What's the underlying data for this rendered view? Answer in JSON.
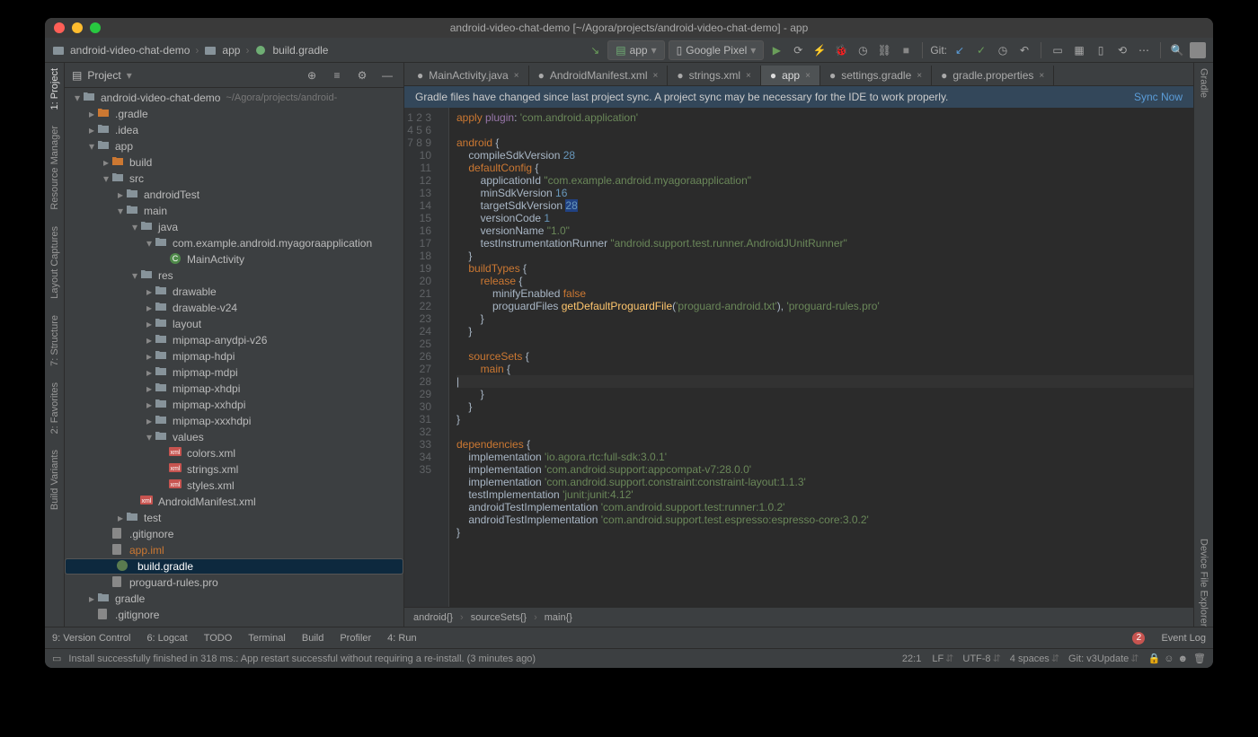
{
  "title": "android-video-chat-demo [~/Agora/projects/android-video-chat-demo] - app",
  "crumbs": [
    "android-video-chat-demo",
    "app",
    "build.gradle"
  ],
  "runconfig": "app",
  "device": "Google Pixel",
  "git_label": "Git:",
  "left_tabs": [
    "1: Project",
    "Resource Manager",
    "Layout Captures",
    "7: Structure",
    "2: Favorites",
    "Build Variants"
  ],
  "right_tabs": [
    "Gradle",
    "Device File Explorer"
  ],
  "proj_label": "Project",
  "tree": [
    {
      "d": 0,
      "c": "▾",
      "i": "fldr",
      "t": "android-video-chat-demo",
      "dim": "~/Agora/projects/android-"
    },
    {
      "d": 1,
      "c": "▸",
      "i": "fldr-o",
      "t": ".gradle"
    },
    {
      "d": 1,
      "c": "▸",
      "i": "fldr",
      "t": ".idea"
    },
    {
      "d": 1,
      "c": "▾",
      "i": "fldr",
      "t": "app"
    },
    {
      "d": 2,
      "c": "▸",
      "i": "fldr-o",
      "t": "build"
    },
    {
      "d": 2,
      "c": "▾",
      "i": "fldr",
      "t": "src"
    },
    {
      "d": 3,
      "c": "▸",
      "i": "fldr",
      "t": "androidTest"
    },
    {
      "d": 3,
      "c": "▾",
      "i": "fldr",
      "t": "main"
    },
    {
      "d": 4,
      "c": "▾",
      "i": "fldr",
      "t": "java"
    },
    {
      "d": 5,
      "c": "▾",
      "i": "fldr",
      "t": "com.example.android.myagoraapplication"
    },
    {
      "d": 6,
      "c": "",
      "i": "cls",
      "t": "MainActivity"
    },
    {
      "d": 4,
      "c": "▾",
      "i": "fldr",
      "t": "res"
    },
    {
      "d": 5,
      "c": "▸",
      "i": "fldr",
      "t": "drawable"
    },
    {
      "d": 5,
      "c": "▸",
      "i": "fldr",
      "t": "drawable-v24"
    },
    {
      "d": 5,
      "c": "▸",
      "i": "fldr",
      "t": "layout"
    },
    {
      "d": 5,
      "c": "▸",
      "i": "fldr",
      "t": "mipmap-anydpi-v26"
    },
    {
      "d": 5,
      "c": "▸",
      "i": "fldr",
      "t": "mipmap-hdpi"
    },
    {
      "d": 5,
      "c": "▸",
      "i": "fldr",
      "t": "mipmap-mdpi"
    },
    {
      "d": 5,
      "c": "▸",
      "i": "fldr",
      "t": "mipmap-xhdpi"
    },
    {
      "d": 5,
      "c": "▸",
      "i": "fldr",
      "t": "mipmap-xxhdpi"
    },
    {
      "d": 5,
      "c": "▸",
      "i": "fldr",
      "t": "mipmap-xxxhdpi"
    },
    {
      "d": 5,
      "c": "▾",
      "i": "fldr",
      "t": "values"
    },
    {
      "d": 6,
      "c": "",
      "i": "xml",
      "t": "colors.xml"
    },
    {
      "d": 6,
      "c": "",
      "i": "xml",
      "t": "strings.xml"
    },
    {
      "d": 6,
      "c": "",
      "i": "xml",
      "t": "styles.xml"
    },
    {
      "d": 4,
      "c": "",
      "i": "xml",
      "t": "AndroidManifest.xml"
    },
    {
      "d": 3,
      "c": "▸",
      "i": "fldr",
      "t": "test"
    },
    {
      "d": 2,
      "c": "",
      "i": "file",
      "t": ".gitignore"
    },
    {
      "d": 2,
      "c": "",
      "i": "file",
      "t": "app.iml",
      "cls": "orange"
    },
    {
      "d": 2,
      "c": "",
      "i": "grd",
      "t": "build.gradle",
      "sel": true
    },
    {
      "d": 2,
      "c": "",
      "i": "file",
      "t": "proguard-rules.pro"
    },
    {
      "d": 1,
      "c": "▸",
      "i": "fldr",
      "t": "gradle"
    },
    {
      "d": 1,
      "c": "",
      "i": "file",
      "t": ".gitignore"
    }
  ],
  "edtabs": [
    {
      "t": "MainActivity.java"
    },
    {
      "t": "AndroidManifest.xml"
    },
    {
      "t": "strings.xml"
    },
    {
      "t": "app",
      "active": true
    },
    {
      "t": "settings.gradle"
    },
    {
      "t": "gradle.properties"
    }
  ],
  "sync_msg": "Gradle files have changed since last project sync. A project sync may be necessary for the IDE to work properly.",
  "sync_link": "Sync Now",
  "gutter_start": 1,
  "gutter_end": 35,
  "edcrumb": [
    "android{}",
    "sourceSets{}",
    "main{}"
  ],
  "bottom": [
    "9: Version Control",
    "6: Logcat",
    "TODO",
    "Terminal",
    "Build",
    "Profiler",
    "4: Run"
  ],
  "event_log": "Event Log",
  "event_badge": "2",
  "status_msg": "Install successfully finished in 318 ms.: App restart successful without requiring a re-install. (3 minutes ago)",
  "status_r": {
    "pos": "22:1",
    "le": "LF",
    "enc": "UTF-8",
    "indent": "4 spaces",
    "git": "Git: v3Update"
  }
}
